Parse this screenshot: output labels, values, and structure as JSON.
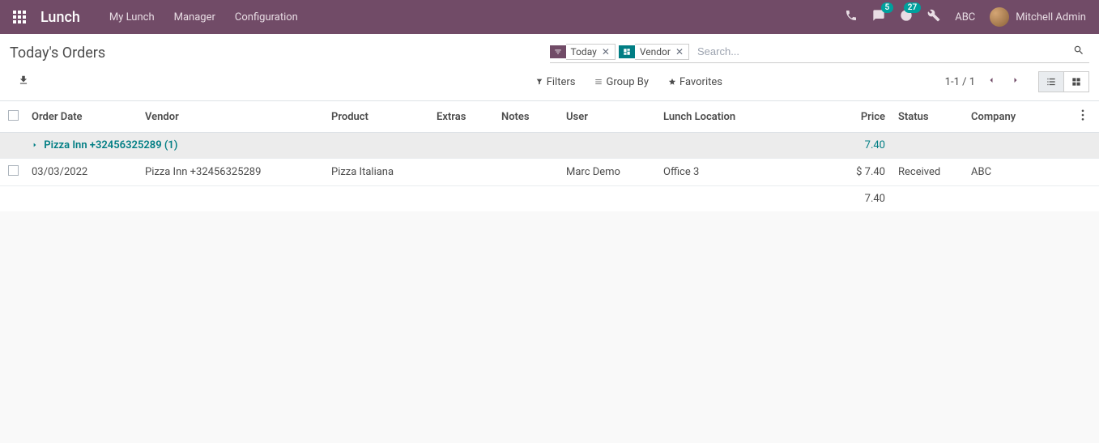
{
  "header": {
    "app_name": "Lunch",
    "menu": [
      "My Lunch",
      "Manager",
      "Configuration"
    ],
    "msg_count": "5",
    "activity_count": "27",
    "company": "ABC",
    "user": "Mitchell Admin"
  },
  "page": {
    "title": "Today's Orders",
    "search": {
      "filter_facet": "Today",
      "group_facet": "Vendor",
      "placeholder": "Search..."
    },
    "options": {
      "filters": "Filters",
      "group_by": "Group By",
      "favorites": "Favorites"
    },
    "pager": {
      "range": "1-1 / 1"
    }
  },
  "table": {
    "columns": {
      "order_date": "Order Date",
      "vendor": "Vendor",
      "product": "Product",
      "extras": "Extras",
      "notes": "Notes",
      "user": "User",
      "lunch_location": "Lunch Location",
      "price": "Price",
      "status": "Status",
      "company": "Company"
    },
    "group": {
      "label": "Pizza Inn +32456325289 (1)",
      "price": "7.40"
    },
    "row": {
      "order_date": "03/03/2022",
      "vendor": "Pizza Inn +32456325289",
      "product": "Pizza Italiana",
      "extras": "",
      "notes": "",
      "user": "Marc Demo",
      "lunch_location": "Office 3",
      "price": "$ 7.40",
      "status": "Received",
      "company": "ABC"
    },
    "total_price": "7.40"
  }
}
